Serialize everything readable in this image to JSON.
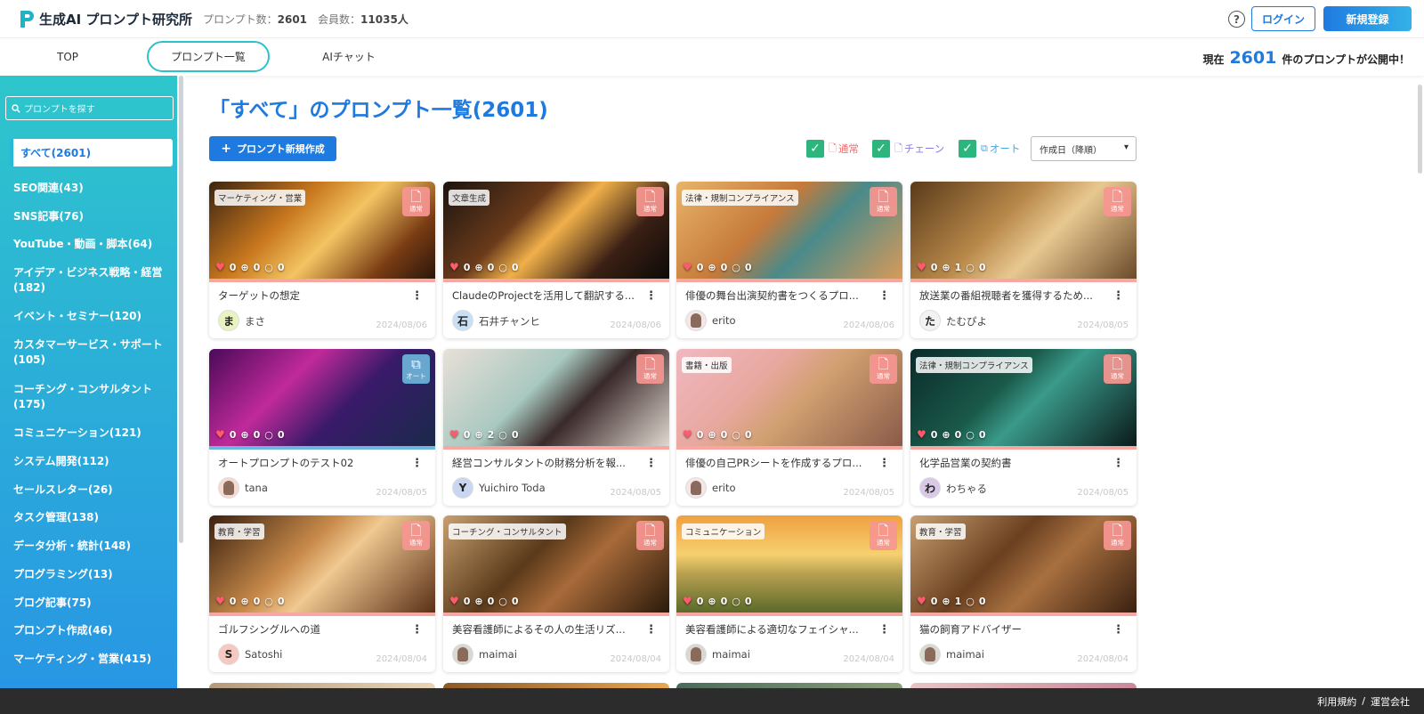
{
  "header": {
    "brand": "生成AI プロンプト研究所",
    "prompt_count_label": "プロンプト数：",
    "prompt_count": "2601",
    "member_count_label": "会員数：",
    "member_count": "11035人",
    "help": "?",
    "login": "ログイン",
    "signup": "新規登録"
  },
  "nav": {
    "tabs": [
      "TOP",
      "プロンプト一覧",
      "AIチャット"
    ],
    "active_tab": "プロンプト一覧",
    "published_prefix": "現在",
    "published_count": "2601",
    "published_suffix": "件のプロンプトが公開中！"
  },
  "sidebar": {
    "search_placeholder": "プロンプトを探す",
    "active_item": "すべて(2601)",
    "items": [
      "SEO関連(43)",
      "SNS記事(76)",
      "YouTube・動画・脚本(64)",
      "アイデア・ビジネス戦略・経営(182)",
      "イベント・セミナー(120)",
      "カスタマーサービス・サポート(105)",
      "コーチング・コンサルタント(175)",
      "コミュニケーション(121)",
      "システム開発(112)",
      "セールスレター(26)",
      "タスク管理(138)",
      "データ分析・統計(148)",
      "プログラミング(13)",
      "ブログ記事(75)",
      "プロンプト作成(46)",
      "マーケティング・営業(415)"
    ]
  },
  "main": {
    "title": "「すべて」のプロンプト一覧(2601)",
    "new_button": "プロンプト新規作成",
    "filters": [
      {
        "label": "通常",
        "color": "#f06a6a"
      },
      {
        "label": "チェーン",
        "color": "#8a7be0"
      },
      {
        "label": "オート",
        "color": "#4aa8e0"
      }
    ],
    "sort_value": "作成日（降順）"
  },
  "badge_labels": {
    "normal": "通常",
    "auto": "オート"
  },
  "cards": [
    {
      "category": "マーケティング・営業",
      "type": "normal",
      "likes": "0",
      "uses": "0",
      "comments": "0",
      "title": "ターゲットの想定",
      "avatar": "ま",
      "author": "まさ",
      "date": "2024/08/06"
    },
    {
      "category": "文章生成",
      "type": "normal",
      "likes": "0",
      "uses": "0",
      "comments": "0",
      "title": "ClaudeのProjectを活用して翻訳する...",
      "avatar": "石",
      "author": "石井チャンヒ",
      "date": "2024/08/06"
    },
    {
      "category": "法律・規制コンプライアンス",
      "type": "normal",
      "likes": "0",
      "uses": "0",
      "comments": "0",
      "title": "俳優の舞台出演契約書をつくるプロ...",
      "avatar": "",
      "author": "erito",
      "date": "2024/08/06"
    },
    {
      "category": "",
      "type": "normal",
      "likes": "0",
      "uses": "1",
      "comments": "0",
      "title": "放送業の番組視聴者を獲得するため...",
      "avatar": "た",
      "author": "たむぴよ",
      "date": "2024/08/05"
    },
    {
      "category": "",
      "type": "auto",
      "likes": "0",
      "uses": "0",
      "comments": "0",
      "title": "オートプロンプトのテスト02",
      "avatar": "",
      "author": "tana",
      "date": "2024/08/05"
    },
    {
      "category": "",
      "type": "normal",
      "likes": "0",
      "uses": "2",
      "comments": "0",
      "title": "経営コンサルタントの財務分析を報...",
      "avatar": "Y",
      "author": "Yuichiro Toda",
      "date": "2024/08/05"
    },
    {
      "category": "書籍・出版",
      "type": "normal",
      "likes": "0",
      "uses": "0",
      "comments": "0",
      "title": "俳優の自己PRシートを作成するプロ...",
      "avatar": "",
      "author": "erito",
      "date": "2024/08/05"
    },
    {
      "category": "法律・規制コンプライアンス",
      "type": "normal",
      "likes": "0",
      "uses": "0",
      "comments": "0",
      "title": "化学品営業の契約書",
      "avatar": "わ",
      "author": "わちゃる",
      "date": "2024/08/05"
    },
    {
      "category": "教育・学習",
      "type": "normal",
      "likes": "0",
      "uses": "0",
      "comments": "0",
      "title": "ゴルフシングルへの道",
      "avatar": "S",
      "author": "Satoshi",
      "date": "2024/08/04"
    },
    {
      "category": "コーチング・コンサルタント",
      "type": "normal",
      "likes": "0",
      "uses": "0",
      "comments": "0",
      "title": "美容看護師によるその人の生活リズ...",
      "avatar": "",
      "author": "maimai",
      "date": "2024/08/04"
    },
    {
      "category": "コミュニケーション",
      "type": "normal",
      "likes": "0",
      "uses": "0",
      "comments": "0",
      "title": "美容看護師による適切なフェイシャ...",
      "avatar": "",
      "author": "maimai",
      "date": "2024/08/04"
    },
    {
      "category": "教育・学習",
      "type": "normal",
      "likes": "0",
      "uses": "1",
      "comments": "0",
      "title": "猫の飼育アドバイザー",
      "avatar": "",
      "author": "maimai",
      "date": "2024/08/04"
    }
  ],
  "footer": {
    "terms": "利用規約",
    "separator": "/",
    "company": "運営会社"
  }
}
